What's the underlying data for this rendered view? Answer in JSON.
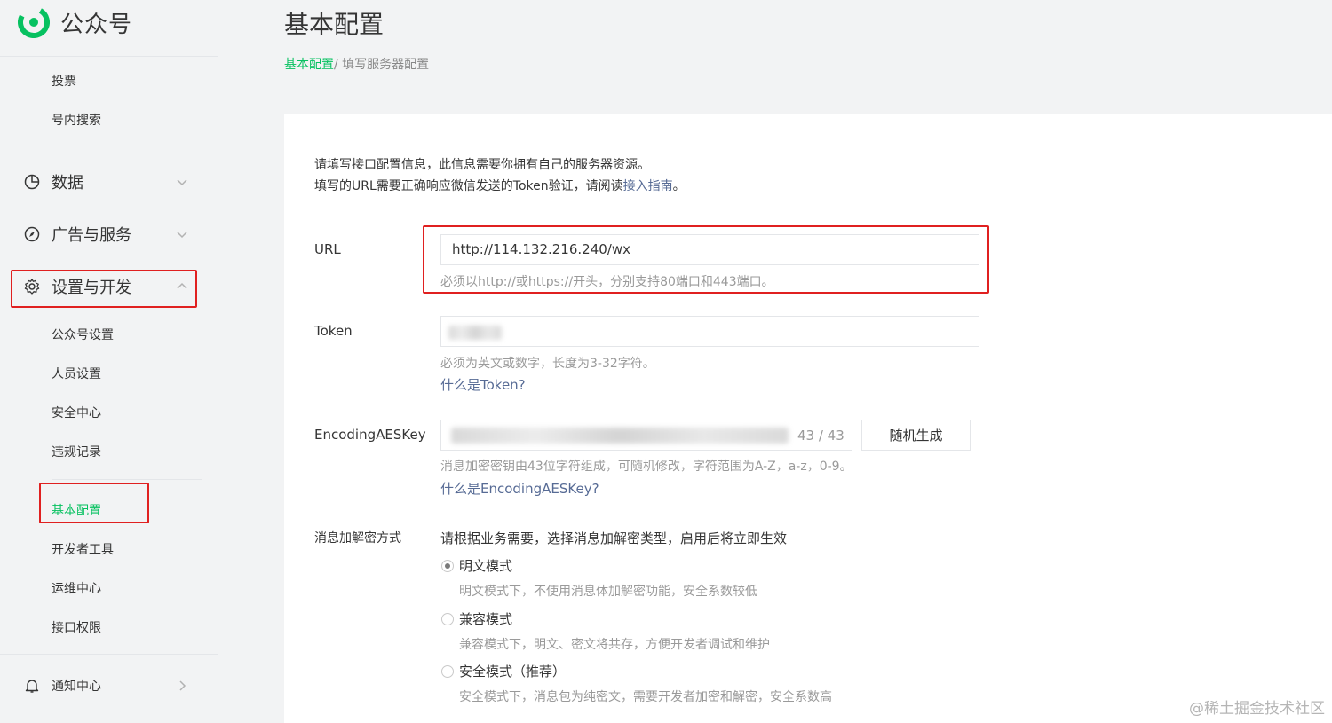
{
  "app": {
    "title": "公众号"
  },
  "sidebar": {
    "top_items": [
      {
        "label": "投票"
      },
      {
        "label": "号内搜索"
      }
    ],
    "groups": {
      "data": {
        "label": "数据"
      },
      "ads": {
        "label": "广告与服务"
      },
      "settings": {
        "label": "设置与开发"
      },
      "notify": {
        "label": "通知中心"
      }
    },
    "settings_items": [
      {
        "label": "公众号设置"
      },
      {
        "label": "人员设置"
      },
      {
        "label": "安全中心"
      },
      {
        "label": "违规记录"
      }
    ],
    "dev_items": [
      {
        "label": "基本配置"
      },
      {
        "label": "开发者工具"
      },
      {
        "label": "运维中心"
      },
      {
        "label": "接口权限"
      }
    ]
  },
  "page": {
    "title": "基本配置",
    "breadcrumb": {
      "parent": "基本配置",
      "current": "/ 填写服务器配置"
    },
    "intro_line1": "请填写接口配置信息，此信息需要你拥有自己的服务器资源。",
    "intro_line2_prefix": "填写的URL需要正确响应微信发送的Token验证，请阅读",
    "intro_link": "接入指南",
    "intro_line2_suffix": "。"
  },
  "form": {
    "url": {
      "label": "URL",
      "value": "http://114.132.216.240/wx",
      "hint": "必须以http://或https://开头，分别支持80端口和443端口。"
    },
    "token": {
      "label": "Token",
      "hint": "必须为英文或数字，长度为3-32字符。",
      "help_link": "什么是Token?"
    },
    "aes": {
      "label": "EncodingAESKey",
      "counter": "43 / 43",
      "random_button": "随机生成",
      "hint": "消息加密密钥由43位字符组成，可随机修改，字符范围为A-Z，a-z，0-9。",
      "help_link": "什么是EncodingAESKey?"
    },
    "mode": {
      "label": "消息加解密方式",
      "description": "请根据业务需要，选择消息加解密类型，启用后将立即生效",
      "options": [
        {
          "label": "明文模式",
          "desc": "明文模式下，不使用消息体加解密功能，安全系数较低",
          "checked": true
        },
        {
          "label": "兼容模式",
          "desc": "兼容模式下，明文、密文将共存，方便开发者调试和维护",
          "checked": false
        },
        {
          "label": "安全模式（推荐）",
          "desc": "安全模式下，消息包为纯密文，需要开发者加密和解密，安全系数高",
          "checked": false
        }
      ]
    }
  },
  "watermark": "@稀土掘金技术社区",
  "colors": {
    "accent": "#07c160",
    "highlight": "#e02020",
    "link": "#576b95"
  }
}
